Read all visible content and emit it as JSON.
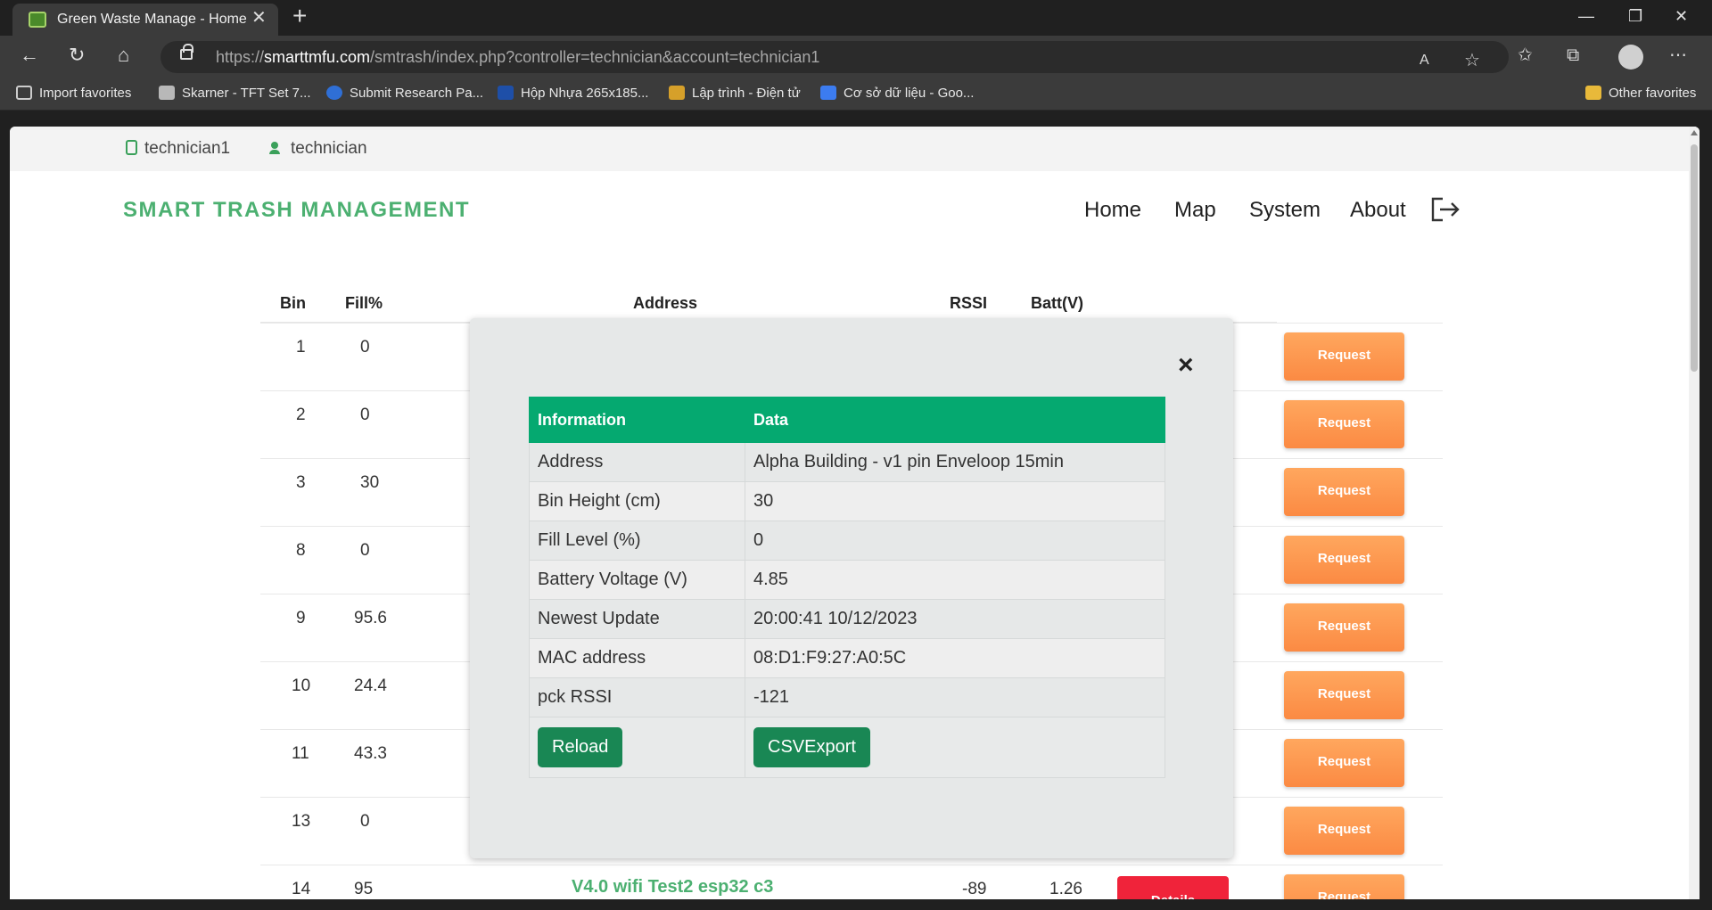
{
  "browser": {
    "tab_title": "Green Waste Manage - Home",
    "url_prefix": "https://",
    "url_host": "smarttmfu.com",
    "url_path": "/smtrash/index.php?controller=technician&account=technician1",
    "favorites": [
      {
        "label": "Import favorites"
      },
      {
        "label": "Skarner - TFT Set 7..."
      },
      {
        "label": "Submit Research Pa..."
      },
      {
        "label": "Hộp Nhựa 265x185..."
      },
      {
        "label": "Lập trình - Điện tử"
      },
      {
        "label": "Cơ sở dữ liệu - Goo..."
      }
    ],
    "other_favorites": "Other favorites"
  },
  "user": {
    "account": "technician1",
    "role": "technician"
  },
  "header": {
    "brand": "SMART TRASH MANAGEMENT",
    "nav": [
      "Home",
      "Map",
      "System",
      "About"
    ]
  },
  "table": {
    "headers": {
      "bin": "Bin",
      "fill": "Fill%",
      "address": "Address",
      "rssi": "RSSI",
      "batt": "Batt(V)"
    },
    "rows": [
      {
        "bin": "1",
        "fill": "0",
        "status": "red"
      },
      {
        "bin": "2",
        "fill": "0",
        "status": "red"
      },
      {
        "bin": "3",
        "fill": "30",
        "status": "green"
      },
      {
        "bin": "8",
        "fill": "0",
        "status": "red"
      },
      {
        "bin": "9",
        "fill": "95.6",
        "status": "red"
      },
      {
        "bin": "10",
        "fill": "24.4",
        "status": "red"
      },
      {
        "bin": "11",
        "fill": "43.3",
        "status": "red"
      },
      {
        "bin": "13",
        "fill": "0",
        "status": "red"
      },
      {
        "bin": "14",
        "fill": "95",
        "address": "V4.0 wifi Test2 esp32 c3",
        "rssi": "-89",
        "batt": "1.26",
        "status": "red"
      }
    ],
    "details_label": "Details",
    "request_label": "Request"
  },
  "modal": {
    "col_info": "Information",
    "col_data": "Data",
    "rows": [
      {
        "label": "Address",
        "value": "Alpha Building - v1 pin Enveloop 15min"
      },
      {
        "label": "Bin Height (cm)",
        "value": "30"
      },
      {
        "label": "Fill Level (%)",
        "value": "0"
      },
      {
        "label": "Battery Voltage (V)",
        "value": "4.85"
      },
      {
        "label": "Newest Update",
        "value": "20:00:41 10/12/2023"
      },
      {
        "label": "MAC address",
        "value": "08:D1:F9:27:A0:5C"
      },
      {
        "label": "pck RSSI",
        "value": "-121"
      }
    ],
    "reload_label": "Reload",
    "export_label": "CSVExport",
    "close_symbol": "×"
  },
  "colors": {
    "brand_green": "#4cb071",
    "header_green": "#05a970",
    "button_green": "#198754",
    "details_red": "#f0233a",
    "details_green": "#28d92a",
    "request_orange": "#fb8a43"
  }
}
